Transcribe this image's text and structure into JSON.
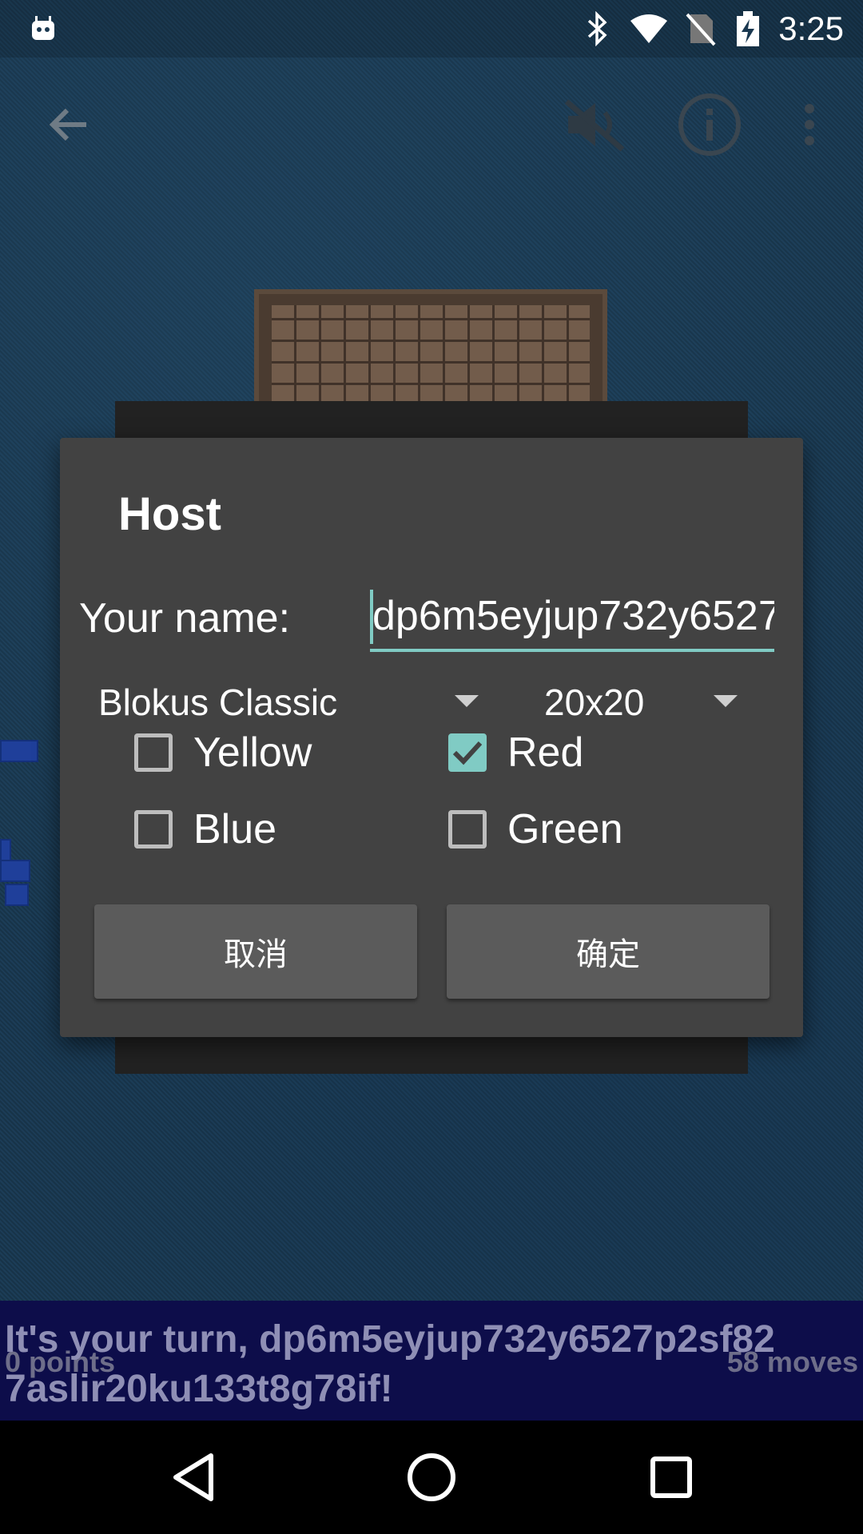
{
  "status_bar": {
    "time": "3:25",
    "icons": [
      "android-icon",
      "bluetooth-icon",
      "wifi-icon",
      "no-sim-icon",
      "battery-charging-icon"
    ]
  },
  "action_bar": {
    "icons": [
      "back-arrow-icon",
      "volume-muted-icon",
      "info-icon",
      "overflow-menu-icon"
    ]
  },
  "dialog": {
    "title": "Host",
    "name_label": "Your name:",
    "name_value": "dp6m5eyjup732y6527p2sf827aslir20ku133t8g78if",
    "game_type": "Blokus Classic",
    "board_size": "20x20",
    "colors": [
      {
        "label": "Yellow",
        "checked": false
      },
      {
        "label": "Red",
        "checked": true
      },
      {
        "label": "Blue",
        "checked": false
      },
      {
        "label": "Green",
        "checked": false
      }
    ],
    "cancel_label": "取消",
    "ok_label": "确定",
    "accent_color": "#80cbc4"
  },
  "status_strip": {
    "points": "0 points",
    "moves": "58 moves",
    "turn_message": "It's your turn, dp6m5eyjup732y6527p2sf82 7aslir20ku133t8g78if!"
  },
  "nav_bar": {
    "icons": [
      "back-triangle-icon",
      "home-circle-icon",
      "recents-square-icon"
    ]
  }
}
